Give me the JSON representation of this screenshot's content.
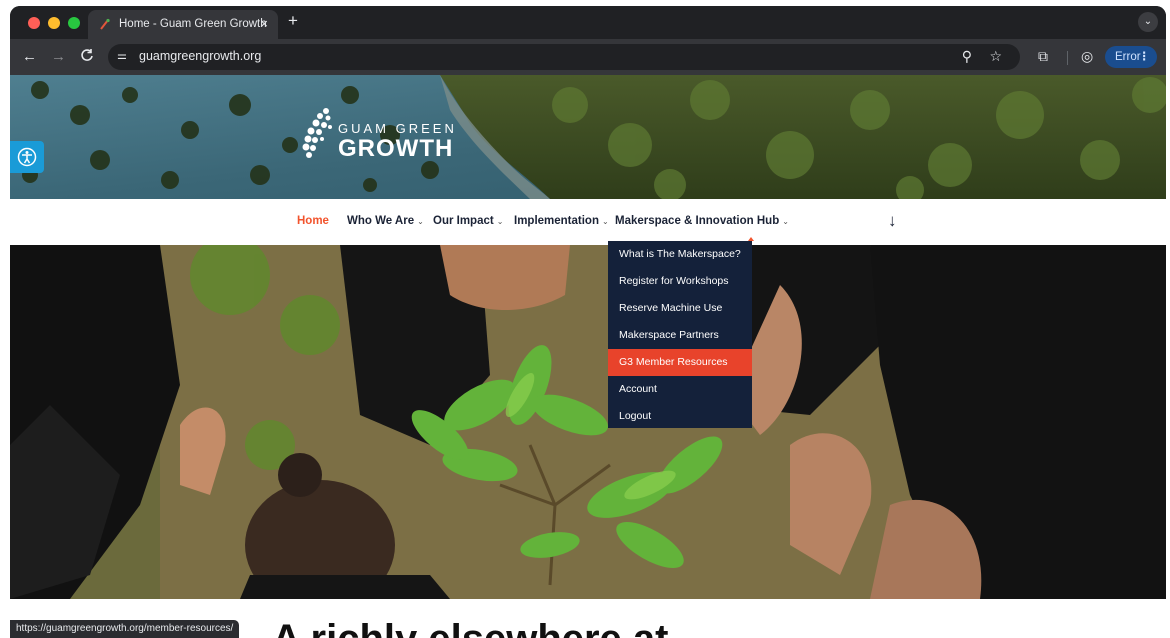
{
  "browser": {
    "tab_title": "Home - Guam Green Growth",
    "tab_close": "×",
    "new_tab": "+",
    "tab_menu": "⌄",
    "url": "guamgreengrowth.org",
    "site_info_icon": "⚌",
    "back_icon": "←",
    "forward_icon": "→",
    "reload_icon": "C",
    "zoom_icon": "⚲",
    "star_icon": "☆",
    "extensions_icon": "⧉",
    "profile_icon": "◎",
    "error_label": "Error",
    "error_menu": "⋮",
    "status_url": "https://guamgreengrowth.org/member-resources/"
  },
  "site": {
    "logo_line1": "GUAM GREEN",
    "logo_line2": "GROWTH",
    "accessibility_icon": "accessibility-icon",
    "nav": [
      {
        "label": "Home",
        "chevron": ""
      },
      {
        "label": "Who We Are",
        "chevron": "⌄"
      },
      {
        "label": "Our Impact",
        "chevron": "⌄"
      },
      {
        "label": "Implementation",
        "chevron": "⌄"
      },
      {
        "label": "Makerspace & Innovation Hub",
        "chevron": "⌄"
      }
    ],
    "nav_arrow": "↓",
    "dropdown": [
      "What is The Makerspace?",
      "Register for Workshops",
      "Reserve Machine Use",
      "Makerspace Partners",
      "G3 Member Resources",
      "Account",
      "Logout"
    ],
    "heading_partial": "A richly elsewhere at"
  },
  "colors": {
    "accent": "#f2542d",
    "dropdown_bg": "#14213a",
    "dropdown_highlight": "#e8432b",
    "nav_text": "#1b2336"
  }
}
